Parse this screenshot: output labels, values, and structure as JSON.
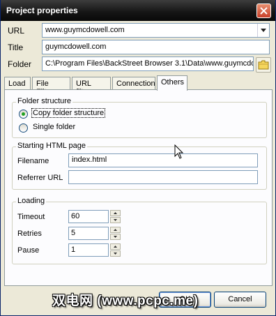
{
  "window": {
    "title": "Project properties"
  },
  "fields": {
    "url_label": "URL",
    "url_value": "www.guymcdowell.com",
    "title_label": "Title",
    "title_value": "guymcdowell.com",
    "folder_label": "Folder",
    "folder_value": "C:\\Program Files\\BackStreet Browser 3.1\\Data\\www.guymcdo"
  },
  "tabs": [
    {
      "label": "Load",
      "active": false
    },
    {
      "label": "File Filter",
      "active": false
    },
    {
      "label": "URL filter",
      "active": false
    },
    {
      "label": "Connection",
      "active": false
    },
    {
      "label": "Others",
      "active": true
    }
  ],
  "folder_structure": {
    "title": "Folder structure",
    "options": [
      {
        "label": "Copy folder structure",
        "selected": true
      },
      {
        "label": "Single folder",
        "selected": false
      }
    ]
  },
  "starting_page": {
    "title": "Starting HTML page",
    "filename_label": "Filename",
    "filename_value": "index.html",
    "referrer_label": "Referrer URL",
    "referrer_value": ""
  },
  "loading": {
    "title": "Loading",
    "timeout_label": "Timeout",
    "timeout_value": "60",
    "retries_label": "Retries",
    "retries_value": "5",
    "pause_label": "Pause",
    "pause_value": "1"
  },
  "buttons": {
    "ok_label": "OK",
    "cancel_label": "Cancel"
  },
  "watermark": "双电网 (www.pcpc.me)",
  "colors": {
    "titlebar": "#151515",
    "dialog_bg": "#ece9d8",
    "close_button": "#c8402a",
    "radio_dot": "#21a121"
  }
}
